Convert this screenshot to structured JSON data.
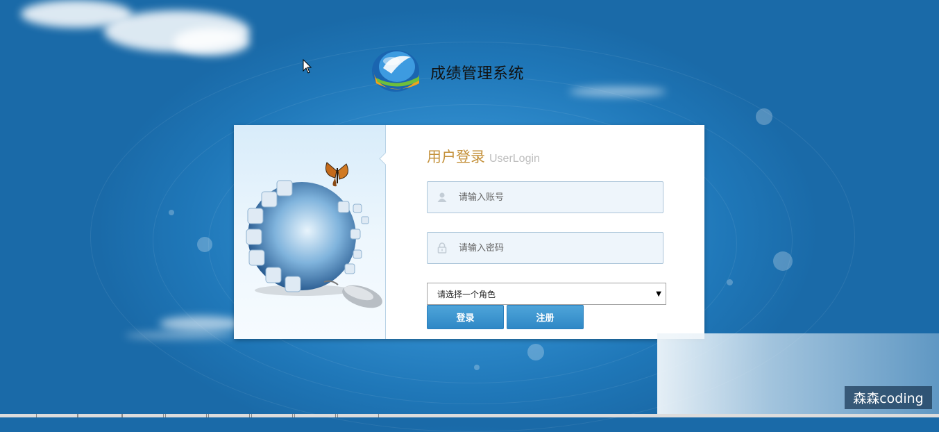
{
  "app": {
    "title": "成绩管理系统"
  },
  "login": {
    "heading_cn": "用户登录",
    "heading_en": "UserLogin",
    "username_placeholder": "请输入账号",
    "password_placeholder": "请输入密码",
    "role_select_value": "请选择一个角色",
    "login_button": "登录",
    "register_button": "注册"
  },
  "overlay": {
    "watermark": "森森coding"
  },
  "icons": {
    "user": "user-icon",
    "lock": "lock-icon",
    "dropdown": "chevron-down-icon",
    "logo": "app-logo",
    "illustration": "globe-puzzle-illustration"
  },
  "colors": {
    "background": "#2e8acb",
    "heading_accent": "#c4913b",
    "button": "#3a93cf",
    "field_bg": "#eef5fb"
  }
}
